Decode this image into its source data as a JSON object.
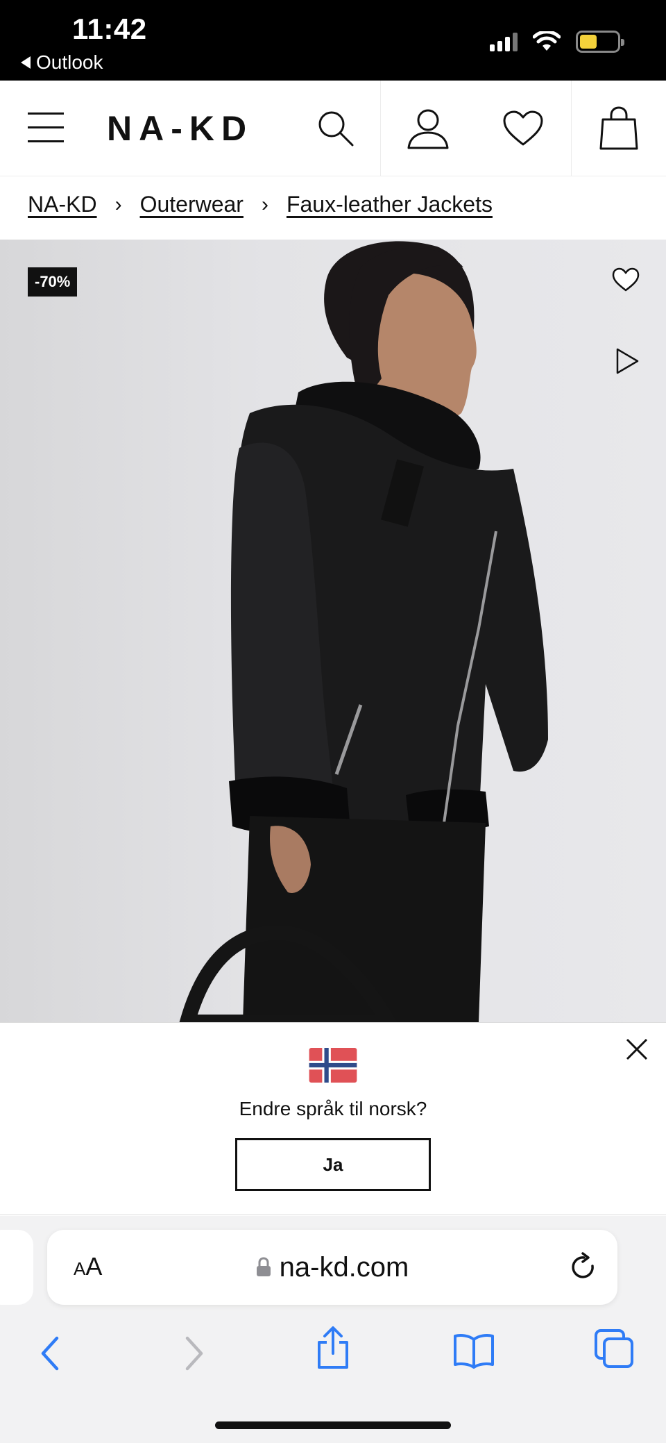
{
  "status_bar": {
    "time": "11:42",
    "back_app": "Outlook",
    "icons": [
      "signal-icon",
      "wifi-icon",
      "battery-icon"
    ],
    "battery_level": 0.35
  },
  "header": {
    "logo": "NA-KD",
    "icons": [
      "menu-icon",
      "search-icon",
      "account-icon",
      "heart-icon",
      "bag-icon"
    ]
  },
  "breadcrumb": {
    "items": [
      "NA-KD",
      "Outerwear",
      "Faux-leather Jackets"
    ],
    "separator": "›"
  },
  "product": {
    "image_alt": "Black faux-leather aviator jacket with black faux-fur collar",
    "discount": "-70%",
    "icons": [
      "heart-icon",
      "play-icon"
    ]
  },
  "language_banner": {
    "flag": "norway-flag",
    "question": "Endre språk til norsk?",
    "confirm_label": "Ja",
    "close_icon": "close-icon"
  },
  "browser": {
    "aa_large": "A",
    "aa_small": "A",
    "url": "na-kd.com",
    "icons": [
      "lock-icon",
      "reload-icon",
      "back-icon",
      "forward-icon",
      "share-icon",
      "bookmarks-icon",
      "tabs-icon"
    ],
    "accent_color": "#2f7cf6"
  }
}
